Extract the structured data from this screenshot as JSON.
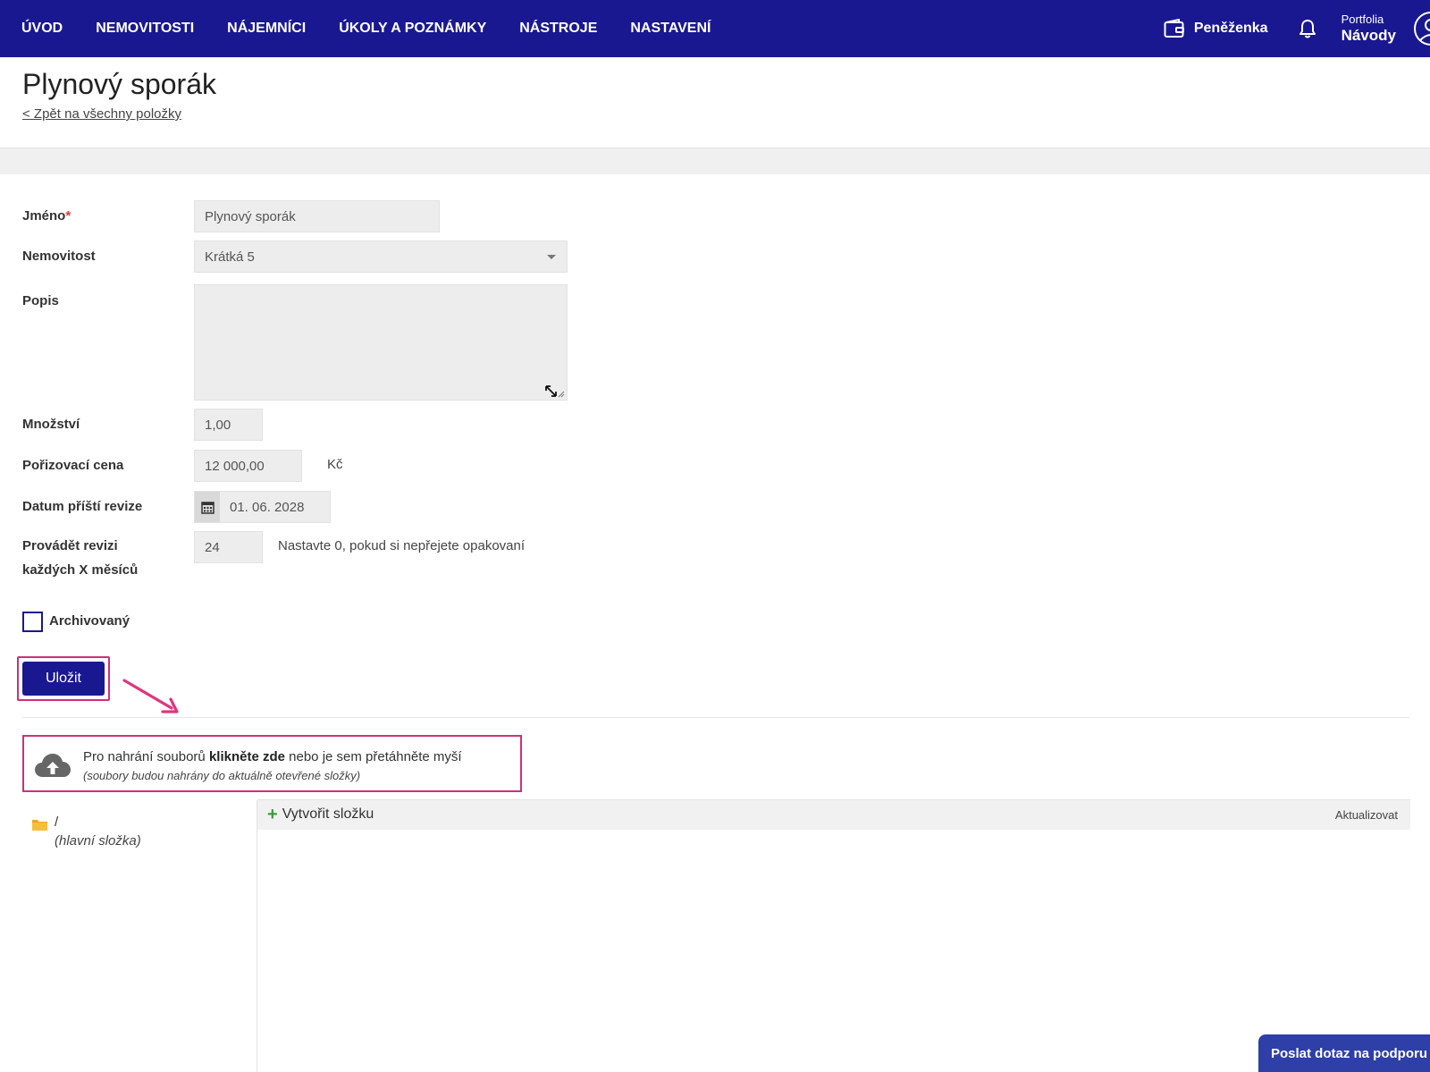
{
  "nav": {
    "items": [
      {
        "label": "ÚVOD"
      },
      {
        "label": "NEMOVITOSTI"
      },
      {
        "label": "NÁJEMNÍCI"
      },
      {
        "label": "ÚKOLY A POZNÁMKY"
      },
      {
        "label": "NÁSTROJE"
      },
      {
        "label": "NASTAVENÍ"
      }
    ],
    "wallet_label": "Peněženka",
    "portfolio_small": "Portfolia",
    "portfolio_big": "Návody"
  },
  "header": {
    "title": "Plynový sporák",
    "back_link": "< Zpět na všechny položky"
  },
  "form": {
    "name_label": "Jméno",
    "required_mark": "*",
    "name_value": "Plynový sporák",
    "property_label": "Nemovitost",
    "property_value": "Krátká 5",
    "description_label": "Popis",
    "quantity_label": "Množství",
    "quantity_value": "1,00",
    "price_label": "Pořizovací cena",
    "price_value": "12 000,00",
    "price_unit": "Kč",
    "revision_date_label": "Datum příští revize",
    "revision_date_value": "01. 06. 2028",
    "interval_label_1": "Provádět revizi",
    "interval_label_2": "každých X měsíců",
    "interval_value": "24",
    "interval_hint": "Nastavte 0, pokud si nepřejete opakovaní",
    "archived_label": "Archivovaný",
    "save_label": "Uložit"
  },
  "upload": {
    "text_before": "Pro nahrání souborů ",
    "text_bold": "klikněte zde",
    "text_after": " nebo je sem přetáhněte myší",
    "subtext": "(soubory budou nahrány do aktuálně otevřené složky)"
  },
  "files": {
    "tree_root": "/",
    "tree_root_sub": "(hlavní složka)",
    "create_folder": "Vytvořit složku",
    "refresh": "Aktualizovat"
  },
  "support": {
    "label": "Poslat dotaz na podporu"
  },
  "colors": {
    "nav_bg": "#1a1890",
    "highlight": "#cf2f79",
    "support_bg": "#2e3fa8"
  }
}
